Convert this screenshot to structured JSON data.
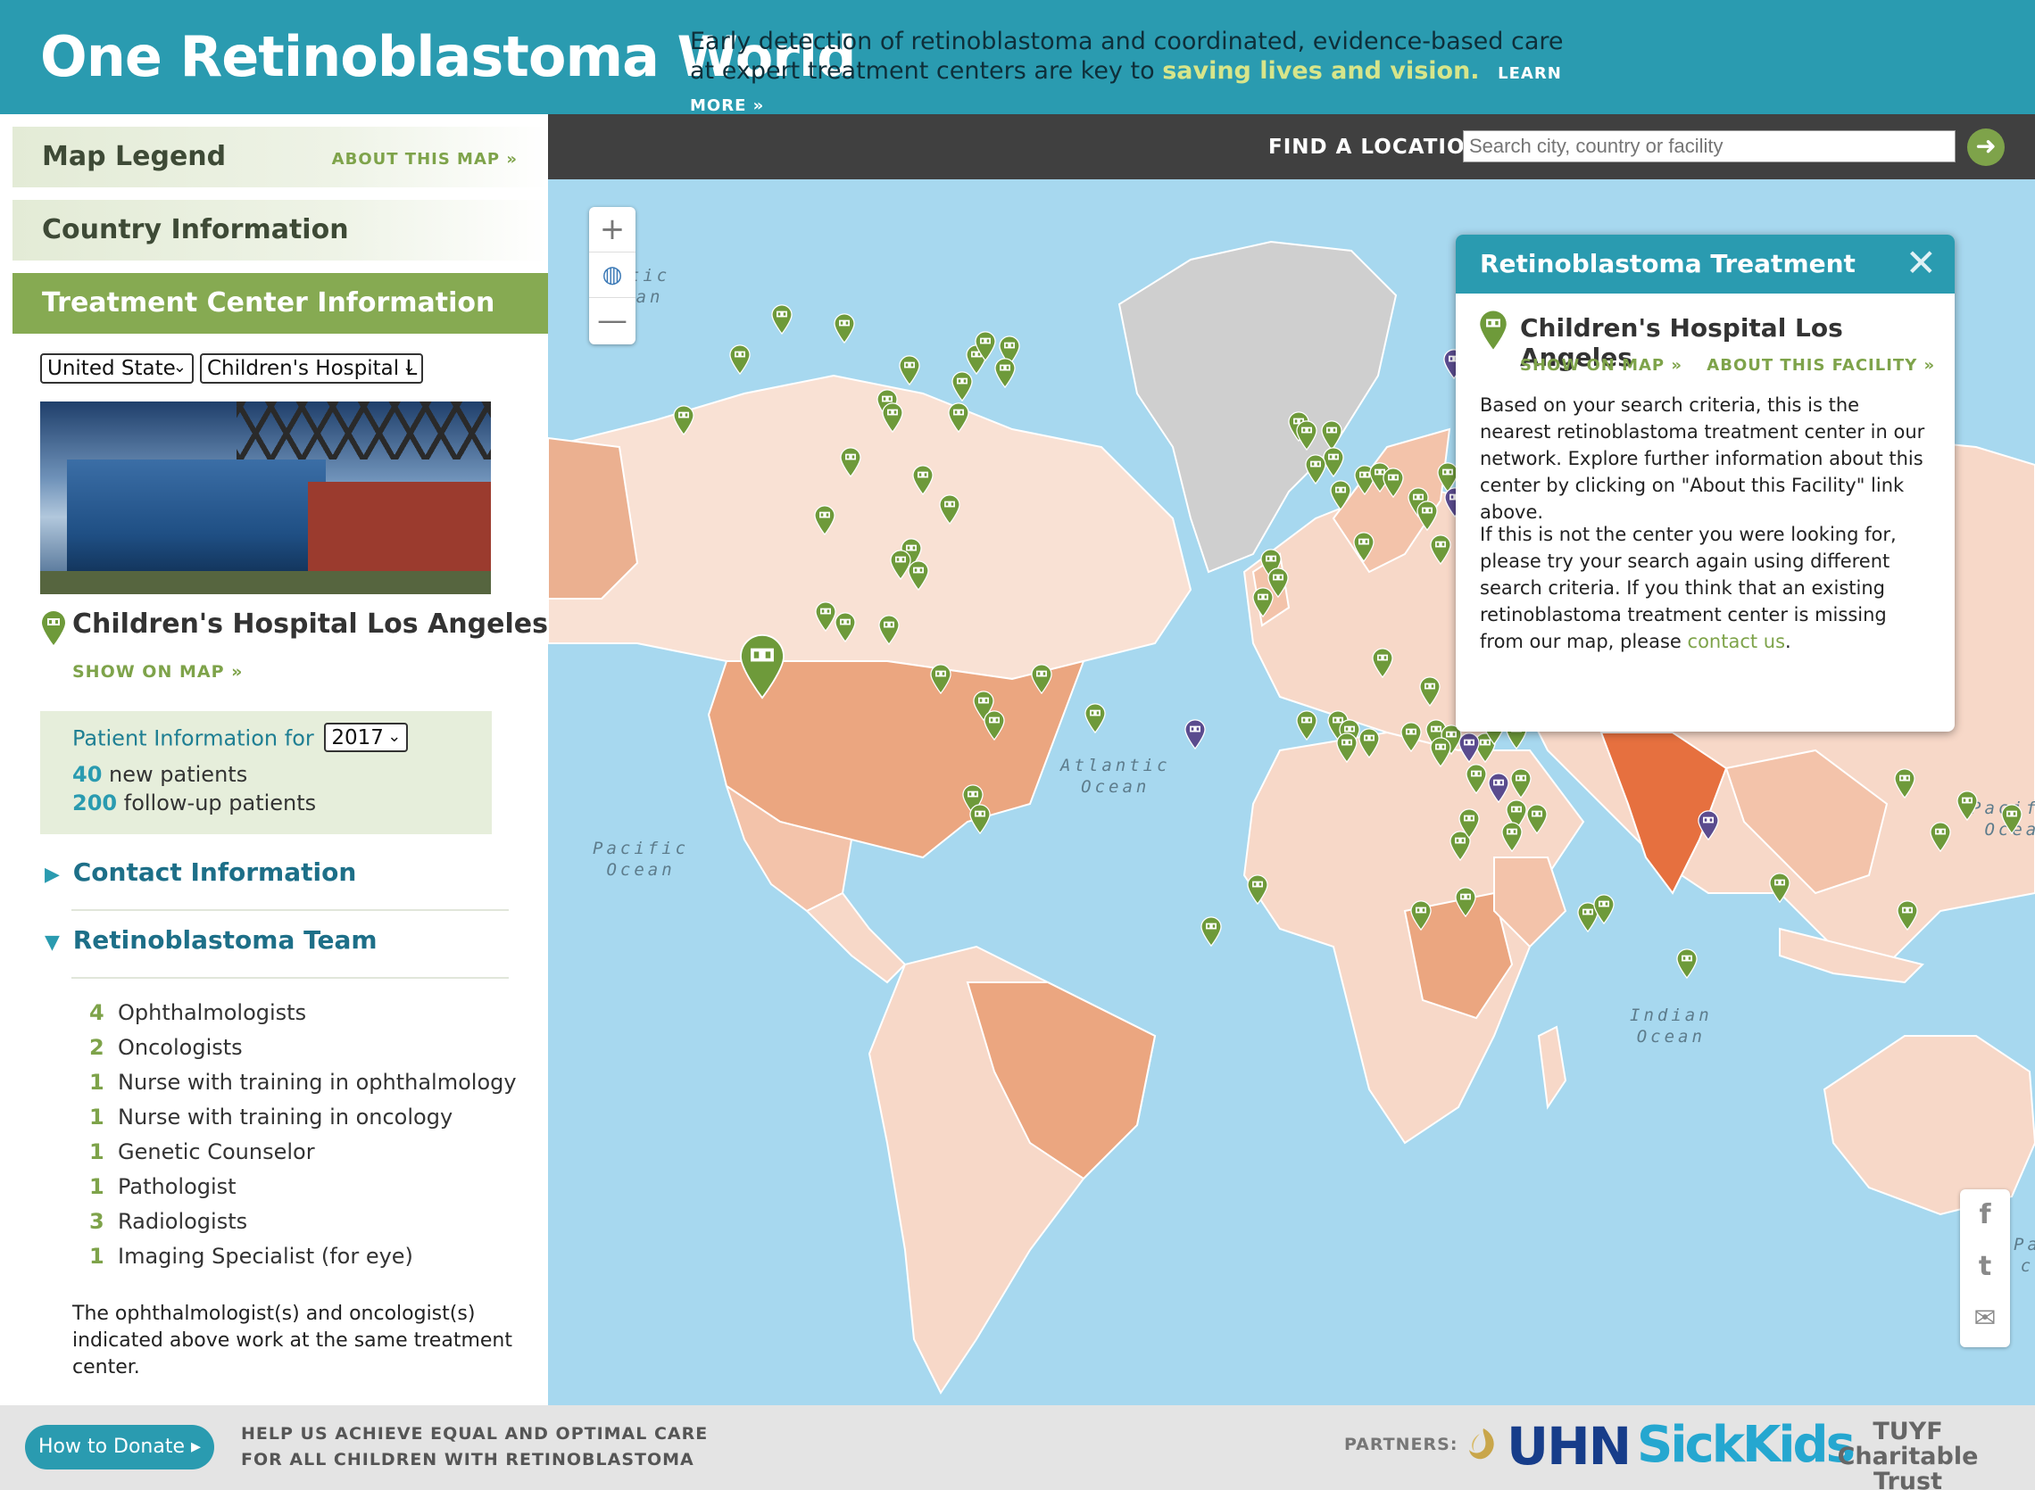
{
  "header": {
    "title": "One Retinoblastoma World",
    "tagline_line1": "Early detection of retinoblastoma and coordinated, evidence-based care",
    "tagline_line2": "at expert treatment centers are key to",
    "tagline_highlight": "saving lives and vision.",
    "learn_more": "LEARN MORE »"
  },
  "sidebar": {
    "map_legend": "Map Legend",
    "about_map": "ABOUT THIS MAP »",
    "country_info": "Country Information",
    "treatment_info": "Treatment Center Information",
    "country_select": "United State",
    "facility_select": "Children's Hospital L",
    "facility_name": "Children's Hospital Los Angeles",
    "show_on_map": "SHOW ON MAP »",
    "patient_label": "Patient Information for",
    "year_select": "2017",
    "new_patients_count": "40",
    "new_patients_label": "new patients",
    "followup_count": "200",
    "followup_label": "follow-up patients",
    "contact_info": "Contact Information",
    "team_heading": "Retinoblastoma Team",
    "team": [
      {
        "count": "4",
        "role": "Ophthalmologists"
      },
      {
        "count": "2",
        "role": "Oncologists"
      },
      {
        "count": "1",
        "role": "Nurse with training in ophthalmology"
      },
      {
        "count": "1",
        "role": "Nurse with training in oncology"
      },
      {
        "count": "1",
        "role": "Genetic Counselor"
      },
      {
        "count": "1",
        "role": "Pathologist"
      },
      {
        "count": "3",
        "role": "Radiologists"
      },
      {
        "count": "1",
        "role": "Imaging Specialist (for eye)"
      }
    ],
    "note": "The ophthalmologist(s) and oncologist(s) indicated above work at the same treatment center."
  },
  "search": {
    "label": "FIND A LOCATION",
    "placeholder": "Search city, country or facility",
    "go_icon": "arrow-right-icon"
  },
  "map": {
    "zoom_in": "+",
    "zoom_out": "—",
    "oceans": {
      "arctic": "rctic\ncean",
      "atlantic": "Atlantic\nOcean",
      "pacific_w": "Pacific\nOcean",
      "pacific_e": "Pacifi\nOcea",
      "indian": "Indian\nOcean",
      "pacific_se": "Pa\nc"
    }
  },
  "popup": {
    "title": "Retinoblastoma Treatment",
    "close": "✕",
    "facility": "Children's Hospital Los Angeles",
    "show_on_map": "SHOW ON MAP »",
    "about_facility": "ABOUT THIS FACILITY »",
    "para1": "Based on your search criteria, this is the nearest retinoblastoma treatment center in our network. Explore further information about this center by clicking on \"About this Facility\" link above.",
    "para2_prefix": "If this is not the center you were looking for, please try your search again using different search criteria. If you think that an existing retinoblastoma treatment center is missing from our map, please",
    "para2_link": "contact us",
    "para2_suffix": "."
  },
  "social": {
    "facebook": "f",
    "twitter": "t",
    "email": "✉"
  },
  "footer": {
    "donate": "How to Donate ▸",
    "message_line1": "HELP US ACHIEVE EQUAL AND OPTIMAL CARE",
    "message_line2": "FOR ALL CHILDREN WITH RETINOBLASTOMA",
    "partners_label": "PARTNERS:",
    "uhn": "UHN",
    "sickkids": "SickKids",
    "tuyf_line1": "TUYF",
    "tuyf_line2": "Charitable Trust"
  },
  "colors": {
    "brand_teal": "#2a9bb0",
    "accent_green": "#7ea34a",
    "ocean": "#a7d8ef",
    "land": "#f7d8c8",
    "pin_green": "#6e9a3a",
    "pin_purple": "#5a4b8e"
  }
}
